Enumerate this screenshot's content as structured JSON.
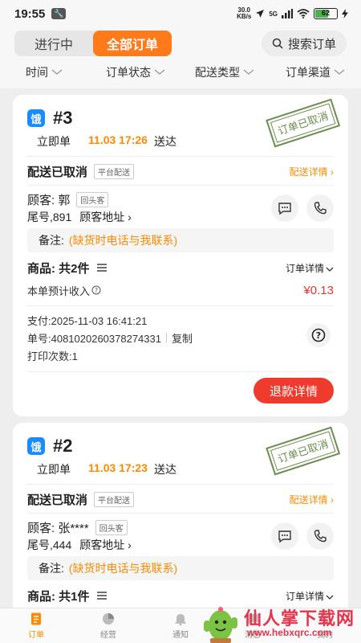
{
  "status_bar": {
    "time": "19:55",
    "net_speed_value": "30.0",
    "net_speed_unit": "KB/s",
    "signal": "5G",
    "battery": "62"
  },
  "header": {
    "tabs": [
      {
        "label": "进行中",
        "active": false
      },
      {
        "label": "全部订单",
        "active": true
      }
    ],
    "search_label": "搜索订单",
    "filters": [
      "时间",
      "订单状态",
      "配送类型",
      "订单渠道"
    ]
  },
  "orders": [
    {
      "platform_badge": "饿",
      "number": "#3",
      "order_type": "立即单",
      "delivery_time": "11.03 17:26",
      "delivery_suffix": "送达",
      "stamp_text": "订单已取消",
      "delivery_status": "配送已取消",
      "delivery_tag": "平台配送",
      "delivery_detail_link": "配送详情 ›",
      "customer_label": "顾客: 郭",
      "customer_tag": "回头客",
      "tail_number": "尾号,891",
      "address_link": "顾客地址 ›",
      "remark_label": "备注:",
      "remark_value": "(缺货时电话与我联系)",
      "goods_label": "商品: 共2件",
      "order_detail_link": "订单详情",
      "income_label": "本单预计收入",
      "income_value": "¥0.13",
      "pay_time": "支付:2025-11-03 16:41:21",
      "order_no": "单号:4081020260378274331",
      "copy_label": "复制",
      "print_count": "打印次数:1",
      "refund_button": "退款详情"
    },
    {
      "platform_badge": "饿",
      "number": "#2",
      "order_type": "立即单",
      "delivery_time": "11.03 17:23",
      "delivery_suffix": "送达",
      "stamp_text": "订单已取消",
      "delivery_status": "配送已取消",
      "delivery_tag": "平台配送",
      "delivery_detail_link": "配送详情 ›",
      "customer_label": "顾客: 张****",
      "customer_tag": "回头客",
      "tail_number": "尾号,444",
      "address_link": "顾客地址 ›",
      "remark_label": "备注:",
      "remark_value": "(缺货时电话与我联系)",
      "goods_label": "商品: 共1件",
      "order_detail_link": "订单详情"
    }
  ],
  "tab_bar": [
    {
      "label": "订单",
      "icon": "orders-icon",
      "active": true
    },
    {
      "label": "经营",
      "icon": "chart-pie-icon",
      "active": false
    },
    {
      "label": "通知",
      "icon": "bell-icon",
      "active": false
    },
    {
      "label": "消息",
      "icon": "message-icon",
      "active": false
    },
    {
      "label": "我的",
      "icon": "user-icon",
      "active": false
    }
  ],
  "watermark": {
    "title": "仙人掌下载网",
    "url": "www.hebxqrc.com"
  },
  "colors": {
    "accent": "#ff7a1a",
    "link": "#ff8a00",
    "price": "#e53935",
    "badge_blue": "#1a8cff",
    "stamp_green": "#6a8f4e",
    "refund": "#ef3b2d"
  }
}
